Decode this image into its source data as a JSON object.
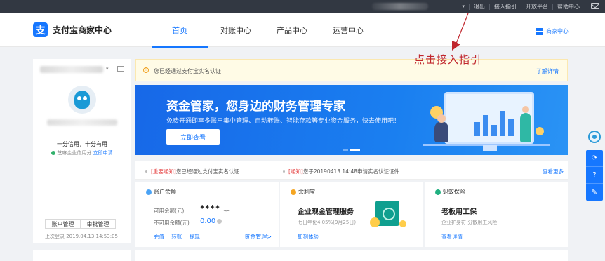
{
  "topbar": {
    "account_caret": "▾",
    "links": [
      "退出",
      "接入指引",
      "开放平台",
      "帮助中心"
    ],
    "mail_icon": "mail-icon"
  },
  "header": {
    "logo_mark": "支",
    "logo_text": "支付宝商家中心",
    "tabs": [
      {
        "label": "首页",
        "active": true
      },
      {
        "label": "对账中心",
        "active": false
      },
      {
        "label": "产品中心",
        "active": false
      },
      {
        "label": "运营中心",
        "active": false
      }
    ],
    "merchant_link": "商家中心"
  },
  "annotation": {
    "text": "点击接入指引",
    "color": "#c0262d"
  },
  "sidebar": {
    "dropdown_caret": "▾",
    "slogan": "一分信用，十分有用",
    "credit_label": "芝麻企业信用分",
    "credit_apply": "立即申请",
    "buttons": [
      "账户管理",
      "审批管理"
    ],
    "last_login": "上次登录 2019.04.13 14:53:05"
  },
  "notice": {
    "icon": "!",
    "text": "您已经通过支付宝实名认证",
    "more": "了解详情"
  },
  "banner": {
    "title": "资金管家，您身边的财务管理专家",
    "subtitle": "免费开通即享多账户集中管理、自动转账、智能存款等专业资金服务，快去使用吧！",
    "cta": "立即查看"
  },
  "notifications": {
    "items": [
      {
        "tag": "[重要通知]",
        "text": "您已经通过支付宝实名认证"
      },
      {
        "tag": "[通知]",
        "text": "您于20190413 14:48申请实名认证证件..."
      }
    ],
    "more": "查看更多"
  },
  "balance_card": {
    "title": "账户余额",
    "available_label": "可用余额(元)",
    "available_value": "****",
    "eye_icon": "‿",
    "unavailable_label": "不可用余额(元)",
    "unavailable_value": "0.00",
    "actions": [
      "充值",
      "转账",
      "提现"
    ],
    "manage": "资金管理>"
  },
  "yulibao_card": {
    "title": "余利宝",
    "headline": "企业现金管理服务",
    "rate": "七日年化4.05%(9月25日)",
    "link": "即刻体验"
  },
  "insurance_card": {
    "title": "蚂蚁保险",
    "headline": "老板用工保",
    "desc": "企业护身符  分散用工风险",
    "link": "查看详情"
  },
  "float_tools": [
    "⟳",
    "?",
    "✎"
  ],
  "colors": {
    "brand": "#1677ff",
    "topbar": "#323842",
    "annotation": "#c0262d"
  }
}
